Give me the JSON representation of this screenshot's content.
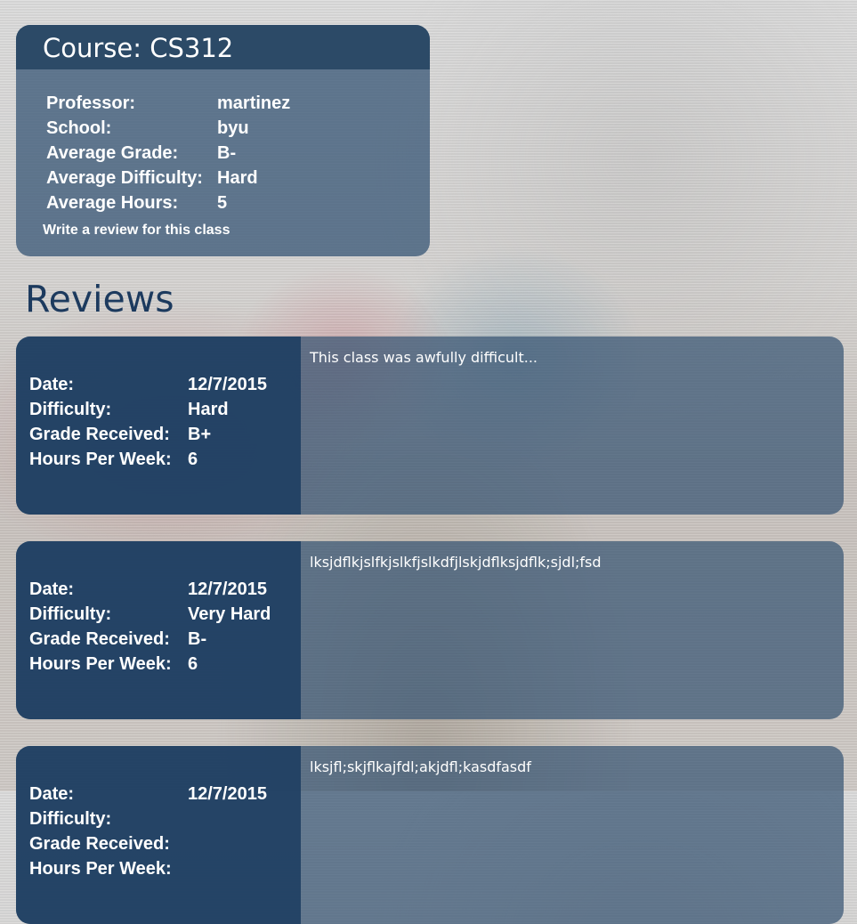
{
  "course": {
    "title": "Course: CS312",
    "rows": [
      {
        "label": "Professor:",
        "value": "martinez"
      },
      {
        "label": "School:",
        "value": "byu"
      },
      {
        "label": "Average Grade:",
        "value": "B-"
      },
      {
        "label": "Average Difficulty:",
        "value": "Hard"
      },
      {
        "label": "Average Hours:",
        "value": "5"
      }
    ],
    "write_review_link": "Write a review for this class"
  },
  "reviews_heading": "Reviews",
  "reviews": [
    {
      "labels": {
        "date": "Date:",
        "difficulty": "Difficulty:",
        "grade": "Grade Received:",
        "hours": "Hours Per Week:"
      },
      "date": "12/7/2015",
      "difficulty": "Hard",
      "grade": "B+",
      "hours": "6",
      "text": "This class was awfully difficult..."
    },
    {
      "labels": {
        "date": "Date:",
        "difficulty": "Difficulty:",
        "grade": "Grade Received:",
        "hours": "Hours Per Week:"
      },
      "date": "12/7/2015",
      "difficulty": "Very Hard",
      "grade": "B-",
      "hours": "6",
      "text": "lksjdflkjslfkjslkfjslkdfjlskjdflksjdflk;sjdl;fsd"
    },
    {
      "labels": {
        "date": "Date:",
        "difficulty": "Difficulty:",
        "grade": "Grade Received:",
        "hours": "Hours Per Week:"
      },
      "date": "12/7/2015",
      "difficulty": "",
      "grade": "",
      "hours": "",
      "text": "lksjfl;skjflkajfdl;akjdfl;kasdfasdf"
    }
  ]
}
